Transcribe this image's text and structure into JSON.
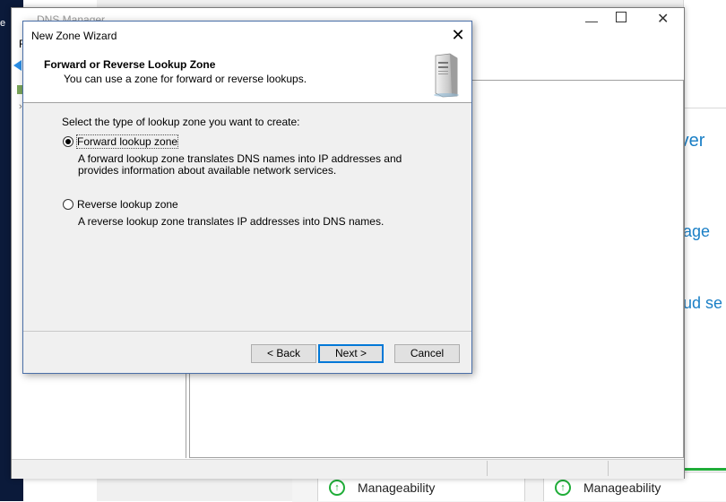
{
  "desktop": {
    "label": "e"
  },
  "dns_manager": {
    "title": "DNS Manager",
    "menu_first": "F",
    "minimize": "—",
    "close": "✕"
  },
  "background": {
    "link_1": "rver",
    "link_2": "nage",
    "link_3": "oud se",
    "manageability_1": "Manageability",
    "manageability_2": "Manageability"
  },
  "wizard": {
    "title": "New Zone Wizard",
    "close": "✕",
    "header_title": "Forward or Reverse Lookup Zone",
    "header_subtitle": "You can use a zone for forward or reverse lookups.",
    "prompt": "Select the type of lookup zone you want to create:",
    "options": [
      {
        "label": "Forward lookup zone",
        "checked": true,
        "description": "A forward lookup zone translates DNS names into IP addresses and provides information about available network services."
      },
      {
        "label": "Reverse lookup zone",
        "checked": false,
        "description": "A reverse lookup zone translates IP addresses into DNS names."
      }
    ],
    "buttons": {
      "back": "< Back",
      "next": "Next >",
      "cancel": "Cancel"
    }
  },
  "colors": {
    "accent": "#0078d7",
    "link": "#1a7fc6",
    "status_green": "#1fad38"
  }
}
